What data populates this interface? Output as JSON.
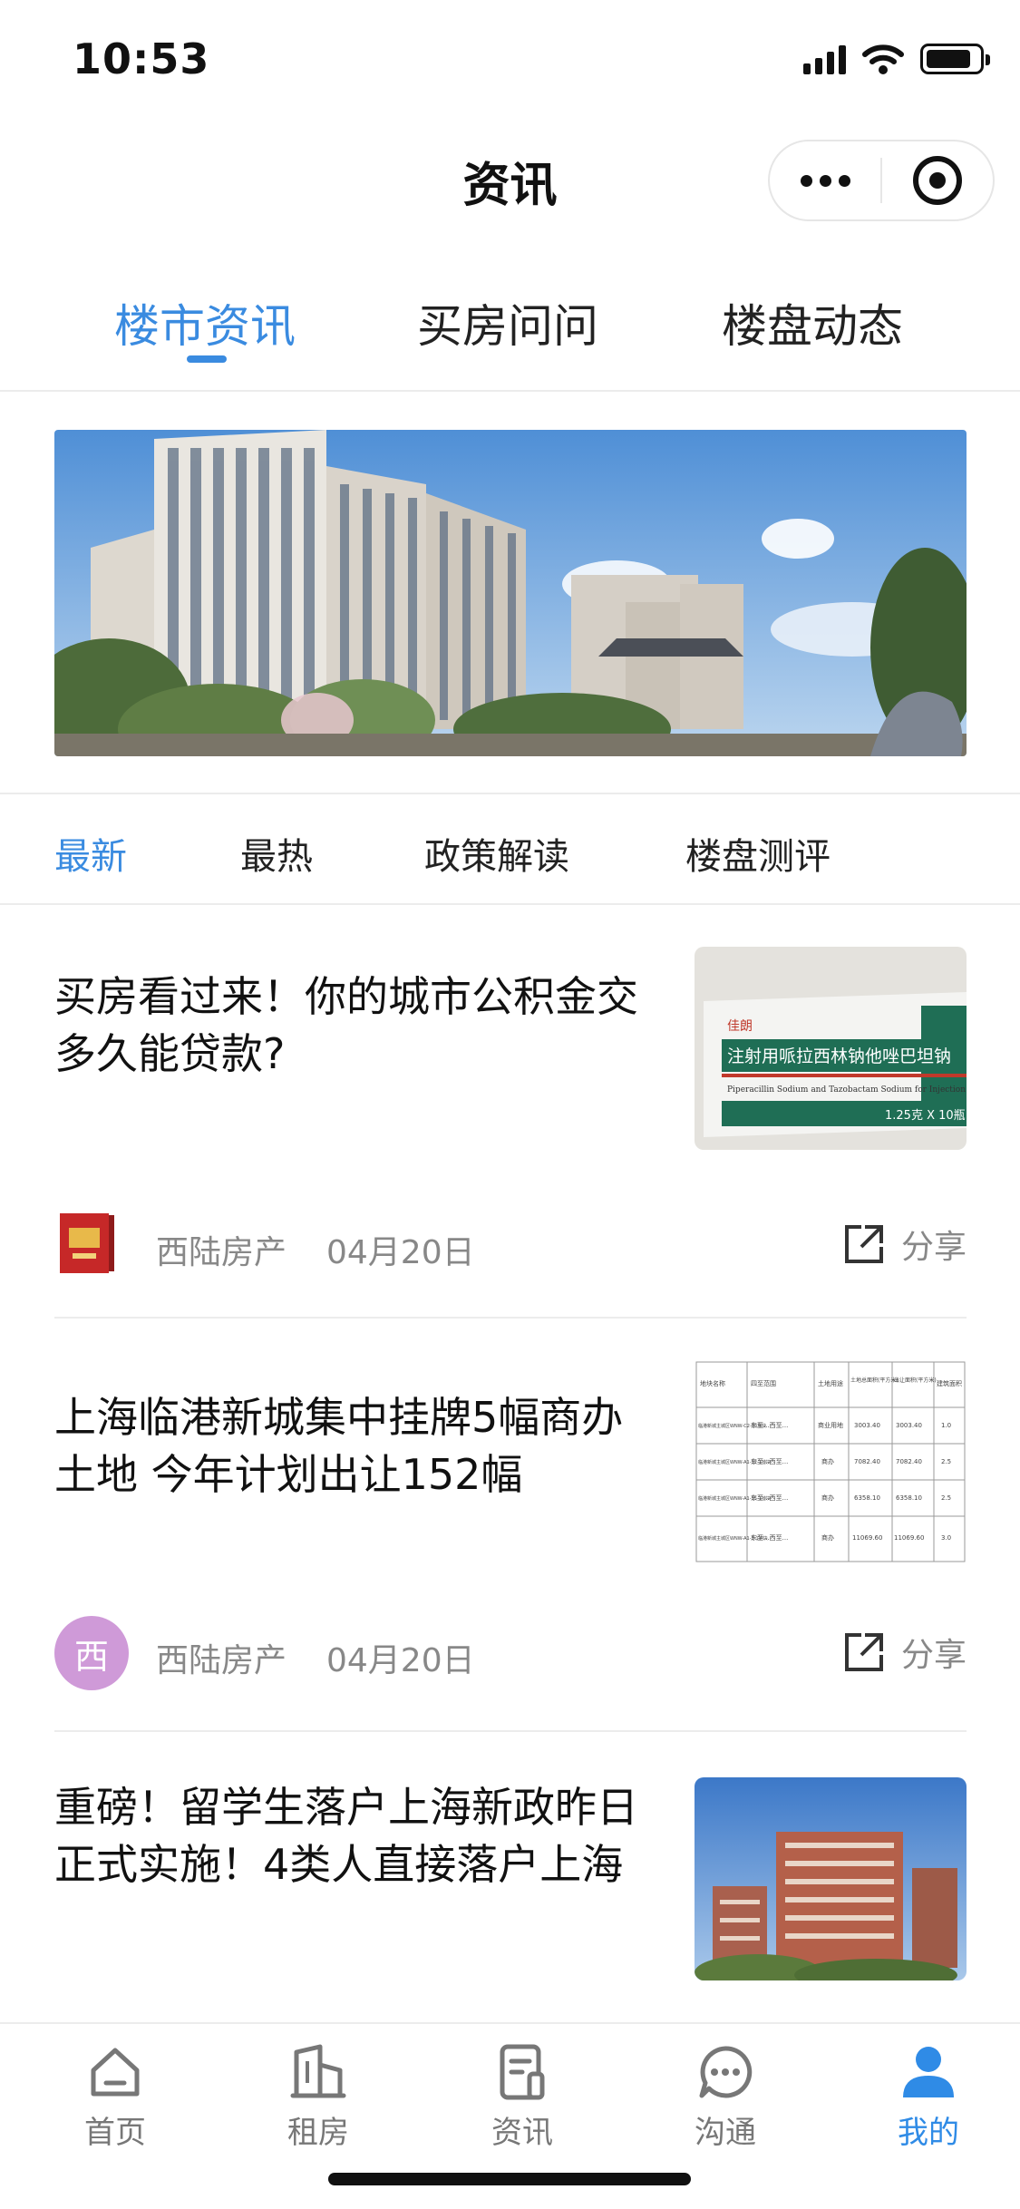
{
  "status_bar": {
    "time": "10:53"
  },
  "nav": {
    "title": "资讯"
  },
  "top_tabs": [
    {
      "label": "楼市资讯",
      "active": true
    },
    {
      "label": "买房问问",
      "active": false
    },
    {
      "label": "楼盘动态",
      "active": false
    }
  ],
  "filter_tabs": [
    {
      "label": "最新",
      "active": true
    },
    {
      "label": "最热",
      "active": false
    },
    {
      "label": "政策解读",
      "active": false
    },
    {
      "label": "楼盘测评",
      "active": false
    }
  ],
  "articles": [
    {
      "title": "买房看过来！你的城市公积金交多久能贷款?",
      "author": "西陆房产",
      "date": "04月20日",
      "share_label": "分享",
      "thumb_text": {
        "brand": "佳朗",
        "cn": "注射用哌拉西林钠他唑巴坦钠",
        "en": "Piperacillin Sodium and Tazobactam Sodium for Injection",
        "spec": "1.25克 X 10瓶"
      }
    },
    {
      "title": "上海临港新城集中挂牌5幅商办土地 今年计划出让152幅",
      "author": "西陆房产",
      "date": "04月20日",
      "share_label": "分享",
      "avatar_char": "西",
      "thumb_table": {
        "headers": [
          "地块名称",
          "四至范围",
          "土地用途",
          "土地总面积(平方米)",
          "出让面积(平方米)",
          "建筑面积"
        ],
        "rows": [
          [
            "临港新城主城区WNW-C2-03地块",
            "东至...西至...",
            "商业用地",
            "3003.40",
            "3003.40",
            "1.0"
          ],
          [
            "临港新城主城区WNW-A1-12-1地块",
            "东至...西至...",
            "商办",
            "7082.40",
            "7082.40",
            "2.5"
          ],
          [
            "临港新城主城区WNW-A1-15-1地块",
            "东至...西至...",
            "商办",
            "6358.10",
            "6358.10",
            "2.5"
          ],
          [
            "临港新城主城区WNW-A1-2-1地块",
            "东至...西至...",
            "商办",
            "11069.60",
            "11069.60",
            "3.0"
          ]
        ]
      }
    },
    {
      "title": "重磅！留学生落户上海新政昨日正式实施！4类人直接落户上海"
    }
  ],
  "bottom_tabs": [
    {
      "label": "首页",
      "icon": "home-icon",
      "active": false
    },
    {
      "label": "租房",
      "icon": "building-icon",
      "active": false
    },
    {
      "label": "资讯",
      "icon": "news-icon",
      "active": false
    },
    {
      "label": "沟通",
      "icon": "chat-icon",
      "active": false
    },
    {
      "label": "我的",
      "icon": "user-icon",
      "active": true
    }
  ],
  "colors": {
    "accent": "#3a8be0",
    "text": "#222222",
    "muted": "#888888",
    "divider": "#ececec"
  }
}
